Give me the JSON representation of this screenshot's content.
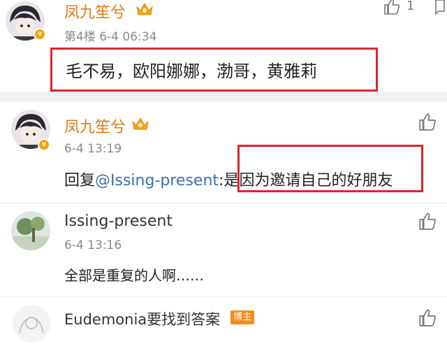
{
  "main_comment": {
    "username": "凤九笙兮",
    "floor_time": "第4楼 6-4 06:34",
    "content": "毛不易，欧阳娜娜，渤哥，黄雅莉",
    "like_count": "1"
  },
  "replies": [
    {
      "username": "凤九笙兮",
      "time": "6-4 13:19",
      "reply_prefix": "回复",
      "mention": "@Issing-present",
      "colon": ":",
      "content": "是因为邀请自己的好朋友"
    },
    {
      "username": "Issing-present",
      "time": "6-4 13:16",
      "content": "全部是重复的人啊……"
    },
    {
      "username": "Eudemonia要找到答案",
      "badge": "博主"
    }
  ],
  "colors": {
    "username_orange": "#e07a16",
    "mention_blue": "#3b6fb0",
    "highlight_red": "#e0242c",
    "verified_badge": "#f5a300",
    "divider_gray": "#f2f2f2"
  },
  "icons": [
    "verified-badge-icon",
    "crown-icon",
    "thumbs-up-icon",
    "reply-icon"
  ]
}
